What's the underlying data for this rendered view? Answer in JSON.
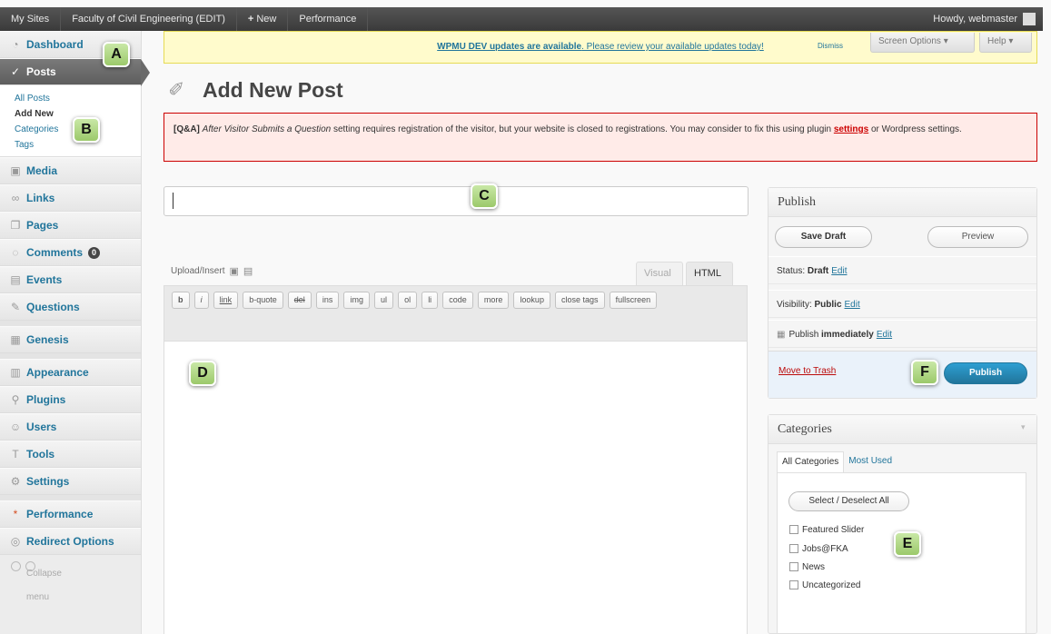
{
  "adminbar": {
    "my_sites": "My Sites",
    "site_name": "Faculty of Civil Engineering (EDIT)",
    "new": "New",
    "performance": "Performance",
    "howdy": "Howdy, webmaster"
  },
  "sidebar": {
    "dashboard": "Dashboard",
    "posts": "Posts",
    "submenu": [
      "All Posts",
      "Add New",
      "Categories",
      "Tags"
    ],
    "media": "Media",
    "links": "Links",
    "pages": "Pages",
    "comments": "Comments",
    "comments_count": "0",
    "events": "Events",
    "questions": "Questions",
    "genesis": "Genesis",
    "appearance": "Appearance",
    "plugins": "Plugins",
    "users": "Users",
    "tools": "Tools",
    "settings": "Settings",
    "performance": "Performance",
    "redirect": "Redirect Options",
    "collapse": "Collapse menu"
  },
  "notice": {
    "link_text": "WPMU DEV updates are available",
    "rest": ". Please review your available updates today!",
    "dismiss": "Dismiss",
    "screen_options": "Screen Options ▾",
    "help": "Help ▾"
  },
  "page": {
    "title": "Add New Post"
  },
  "qa_notice": {
    "tag": "[Q&A]",
    "setting": "After Visitor Submits a Question",
    "text1": " setting requires registration of the visitor, but your website is closed to registrations. You may consider to fix this using plugin ",
    "link": "settings",
    "text2": " or Wordpress settings."
  },
  "editor": {
    "upload_insert": "Upload/Insert",
    "tab_visual": "Visual",
    "tab_html": "HTML",
    "quicktags": [
      "b",
      "i",
      "link",
      "b-quote",
      "del",
      "ins",
      "img",
      "ul",
      "ol",
      "li",
      "code",
      "more",
      "lookup",
      "close tags",
      "fullscreen"
    ]
  },
  "publish": {
    "title": "Publish",
    "save_draft": "Save Draft",
    "preview": "Preview",
    "status_label": "Status: ",
    "status_value": "Draft",
    "visibility_label": "Visibility: ",
    "visibility_value": "Public",
    "publish_label": "Publish ",
    "publish_value": "immediately",
    "edit": "Edit",
    "move_to_trash": "Move to Trash",
    "publish_button": "Publish"
  },
  "categories": {
    "title": "Categories",
    "tab_all": "All Categories",
    "tab_most_used": "Most Used",
    "select_all": "Select / Deselect All",
    "items": [
      "Featured Slider",
      "Jobs@FKA",
      "News",
      "Uncategorized"
    ]
  },
  "callouts": [
    "A",
    "B",
    "C",
    "D",
    "E",
    "F"
  ]
}
